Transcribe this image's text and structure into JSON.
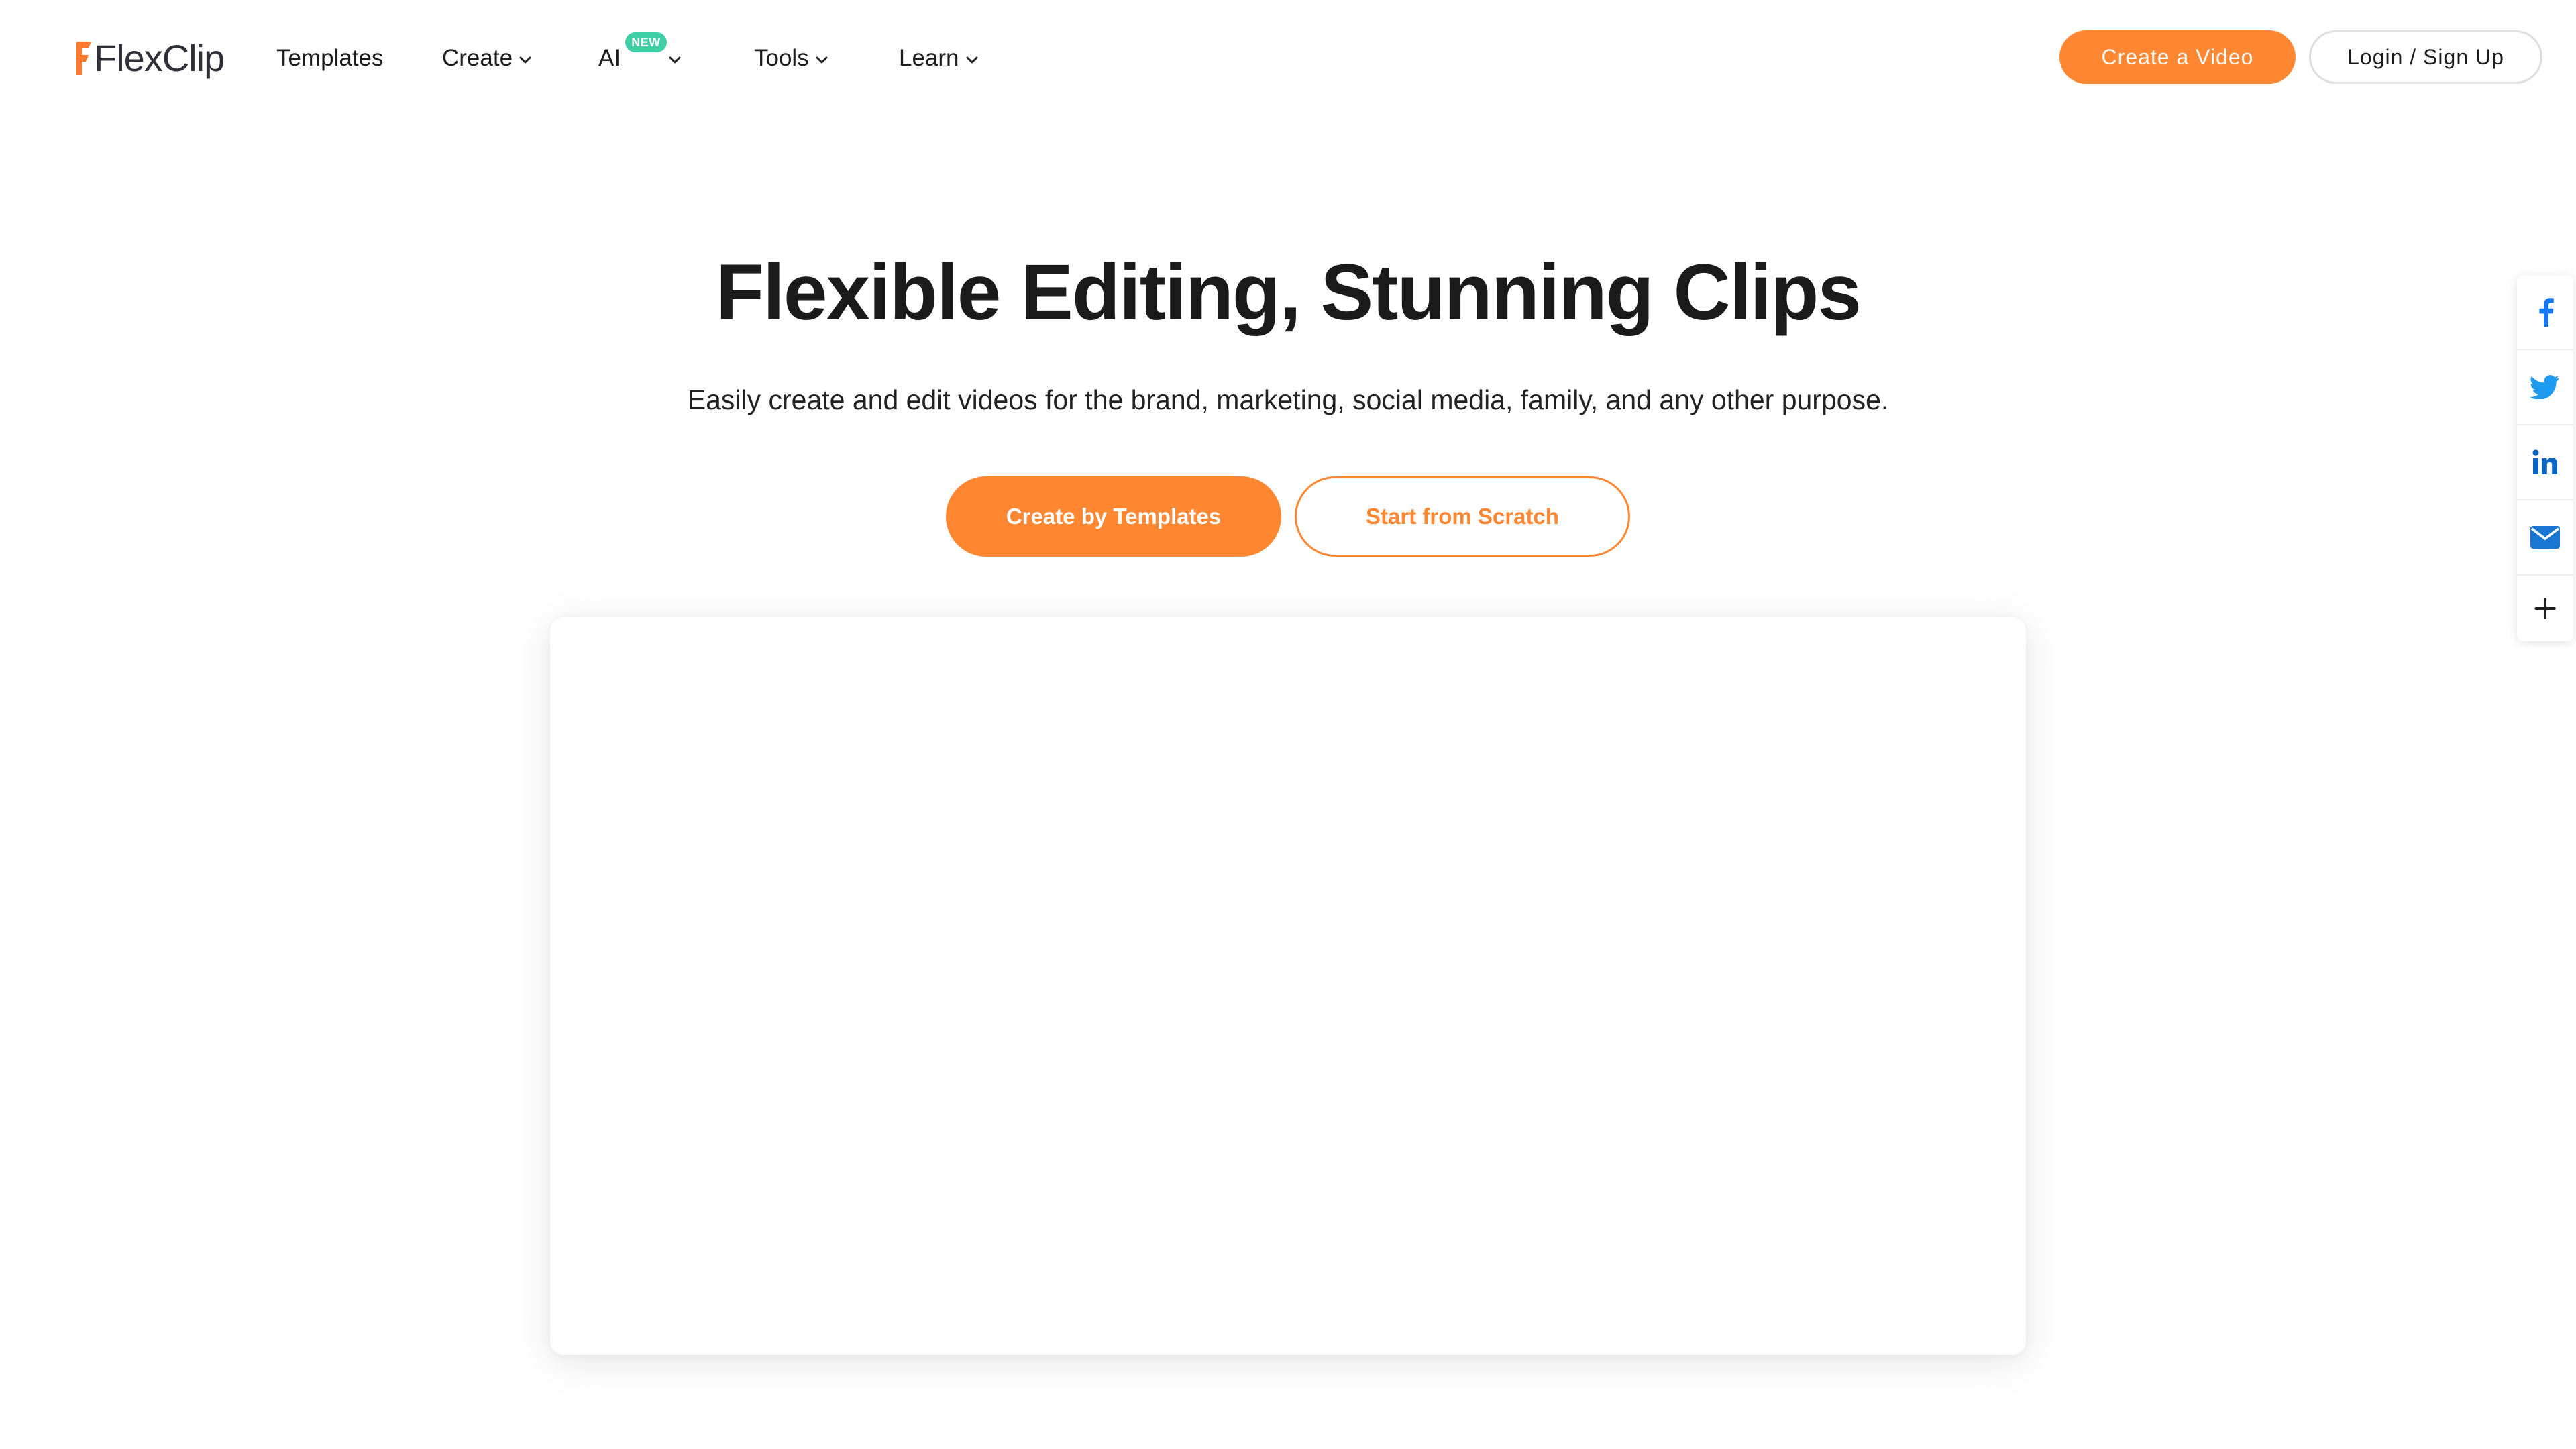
{
  "header": {
    "logo": {
      "text_flex": "Flex",
      "text_clip": "Clip",
      "accent_color": "#ff7a2f"
    },
    "nav": [
      {
        "label": "Templates",
        "has_dropdown": false
      },
      {
        "label": "Create",
        "has_dropdown": true
      },
      {
        "label": "AI",
        "has_dropdown": true,
        "badge": "NEW"
      },
      {
        "label": "Tools",
        "has_dropdown": true
      },
      {
        "label": "Learn",
        "has_dropdown": true
      }
    ],
    "create_video_label": "Create a Video",
    "login_label": "Login / Sign Up"
  },
  "hero": {
    "title": "Flexible Editing, Stunning Clips",
    "subtitle": "Easily create and edit videos for the brand, marketing, social media, family, and any other purpose.",
    "primary_button": "Create by Templates",
    "secondary_button": "Start from Scratch"
  },
  "share_bar": {
    "items": [
      {
        "icon": "facebook-icon",
        "color": "#1877f2"
      },
      {
        "icon": "twitter-icon",
        "color": "#1d9bf0"
      },
      {
        "icon": "linkedin-icon",
        "color": "#0a66c2"
      },
      {
        "icon": "email-icon",
        "color": "#1976d2"
      },
      {
        "icon": "plus-icon",
        "color": "#222222"
      }
    ]
  },
  "colors": {
    "brand_orange": "#ff8731",
    "new_badge": "#3ecfa6",
    "text_dark": "#1a1a1a"
  }
}
